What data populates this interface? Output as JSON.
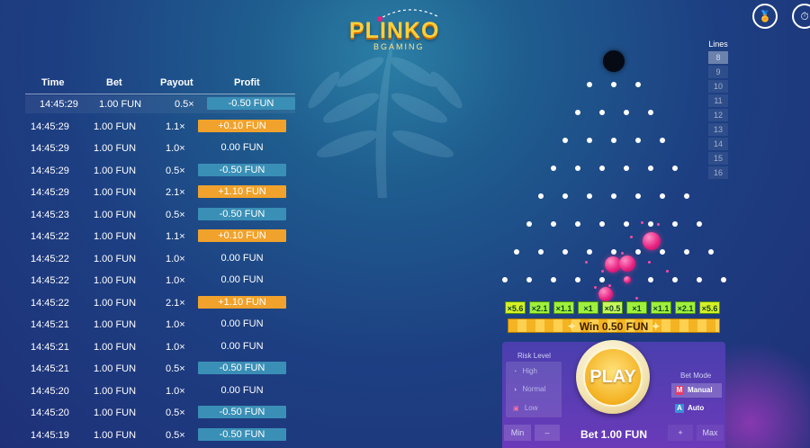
{
  "logo": {
    "main": "PLINKO",
    "sub": "BGAMING"
  },
  "top_icons": [
    {
      "icon": "medal-icon",
      "glyph": "🏅"
    },
    {
      "icon": "history-clock-icon",
      "glyph": "⏱"
    }
  ],
  "history": {
    "headers": [
      "Time",
      "Bet",
      "Payout",
      "Profit"
    ],
    "rows": [
      {
        "time": "14:45:29",
        "bet": "1.00 FUN",
        "payout": "0.5×",
        "profit": "-0.50 FUN",
        "kind": "neg"
      },
      {
        "time": "14:45:29",
        "bet": "1.00 FUN",
        "payout": "1.1×",
        "profit": "+0.10 FUN",
        "kind": "pos"
      },
      {
        "time": "14:45:29",
        "bet": "1.00 FUN",
        "payout": "1.0×",
        "profit": "0.00 FUN",
        "kind": "zero"
      },
      {
        "time": "14:45:29",
        "bet": "1.00 FUN",
        "payout": "0.5×",
        "profit": "-0.50 FUN",
        "kind": "neg"
      },
      {
        "time": "14:45:29",
        "bet": "1.00 FUN",
        "payout": "2.1×",
        "profit": "+1.10 FUN",
        "kind": "pos"
      },
      {
        "time": "14:45:23",
        "bet": "1.00 FUN",
        "payout": "0.5×",
        "profit": "-0.50 FUN",
        "kind": "neg"
      },
      {
        "time": "14:45:22",
        "bet": "1.00 FUN",
        "payout": "1.1×",
        "profit": "+0.10 FUN",
        "kind": "pos"
      },
      {
        "time": "14:45:22",
        "bet": "1.00 FUN",
        "payout": "1.0×",
        "profit": "0.00 FUN",
        "kind": "zero"
      },
      {
        "time": "14:45:22",
        "bet": "1.00 FUN",
        "payout": "1.0×",
        "profit": "0.00 FUN",
        "kind": "zero"
      },
      {
        "time": "14:45:22",
        "bet": "1.00 FUN",
        "payout": "2.1×",
        "profit": "+1.10 FUN",
        "kind": "pos"
      },
      {
        "time": "14:45:21",
        "bet": "1.00 FUN",
        "payout": "1.0×",
        "profit": "0.00 FUN",
        "kind": "zero"
      },
      {
        "time": "14:45:21",
        "bet": "1.00 FUN",
        "payout": "1.0×",
        "profit": "0.00 FUN",
        "kind": "zero"
      },
      {
        "time": "14:45:21",
        "bet": "1.00 FUN",
        "payout": "0.5×",
        "profit": "-0.50 FUN",
        "kind": "neg"
      },
      {
        "time": "14:45:20",
        "bet": "1.00 FUN",
        "payout": "1.0×",
        "profit": "0.00 FUN",
        "kind": "zero"
      },
      {
        "time": "14:45:20",
        "bet": "1.00 FUN",
        "payout": "0.5×",
        "profit": "-0.50 FUN",
        "kind": "neg"
      },
      {
        "time": "14:45:19",
        "bet": "1.00 FUN",
        "payout": "0.5×",
        "profit": "-0.50 FUN",
        "kind": "neg"
      }
    ]
  },
  "board": {
    "peg_rows": 8,
    "multipliers": [
      "×5.6",
      "×2.1",
      "×1.1",
      "×1",
      "×0.5",
      "×1",
      "×1.1",
      "×2.1",
      "×5.6"
    ],
    "win_text": "Win 0.50 FUN"
  },
  "lines": {
    "title": "Lines",
    "options": [
      "8",
      "9",
      "10",
      "11",
      "12",
      "13",
      "14",
      "15",
      "16"
    ],
    "selected": "8"
  },
  "risk": {
    "title": "Risk Level",
    "options": [
      "High",
      "Normal",
      "Low"
    ],
    "icons": [
      "flame-icon",
      "gauge-icon",
      "lock-icon"
    ]
  },
  "mode": {
    "title": "Bet Mode",
    "options": [
      {
        "key": "M",
        "label": "Manual"
      },
      {
        "key": "A",
        "label": "Auto"
      }
    ],
    "selected": "Manual"
  },
  "play_label": "PLAY",
  "bet": {
    "min_label": "Min",
    "minus_label": "–",
    "amount": "Bet 1.00 FUN",
    "plus_label": "+",
    "max_label": "Max"
  },
  "colors": {
    "negative": "#3a8fb6",
    "positive": "#f0a22c",
    "multiplier": "#9ff03c",
    "accent": "#f4b223"
  }
}
